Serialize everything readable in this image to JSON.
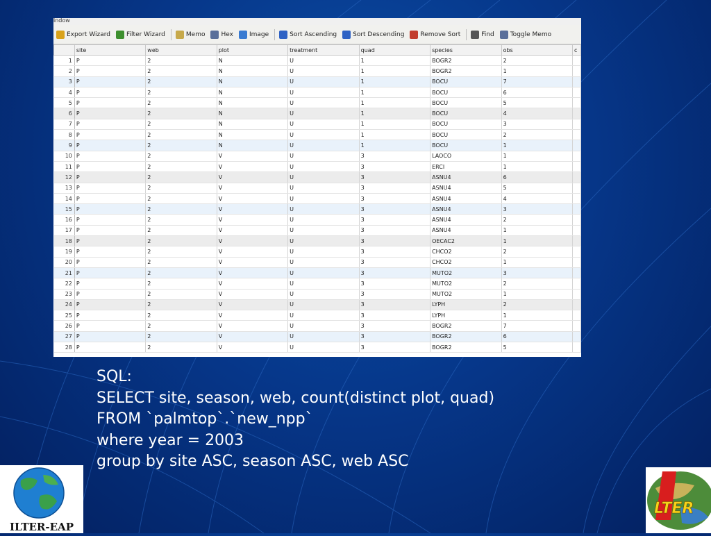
{
  "window": {
    "title": "indow"
  },
  "toolbar": {
    "items": [
      {
        "label": "Export Wizard",
        "icon": "export-icon"
      },
      {
        "label": "Filter Wizard",
        "icon": "filter-icon"
      },
      {
        "label": "Memo",
        "icon": "memo-icon"
      },
      {
        "label": "Hex",
        "icon": "hex-icon"
      },
      {
        "label": "Image",
        "icon": "image-icon"
      },
      {
        "label": "Sort Ascending",
        "icon": "sort-ascending-icon"
      },
      {
        "label": "Sort Descending",
        "icon": "sort-descending-icon"
      },
      {
        "label": "Remove Sort",
        "icon": "remove-sort-icon"
      },
      {
        "label": "Find",
        "icon": "find-icon"
      },
      {
        "label": "Toggle Memo",
        "icon": "toggle-memo-icon"
      }
    ]
  },
  "table": {
    "columns": [
      "site",
      "web",
      "plot",
      "treatment",
      "quad",
      "species",
      "obs",
      "c"
    ],
    "rows": [
      [
        "1",
        "P",
        "2",
        "N",
        "U",
        "1",
        "BOGR2",
        "2"
      ],
      [
        "2",
        "P",
        "2",
        "N",
        "U",
        "1",
        "BOGR2",
        "1"
      ],
      [
        "3",
        "P",
        "2",
        "N",
        "U",
        "1",
        "BOCU",
        "7"
      ],
      [
        "4",
        "P",
        "2",
        "N",
        "U",
        "1",
        "BOCU",
        "6"
      ],
      [
        "5",
        "P",
        "2",
        "N",
        "U",
        "1",
        "BOCU",
        "5"
      ],
      [
        "6",
        "P",
        "2",
        "N",
        "U",
        "1",
        "BOCU",
        "4"
      ],
      [
        "7",
        "P",
        "2",
        "N",
        "U",
        "1",
        "BOCU",
        "3"
      ],
      [
        "8",
        "P",
        "2",
        "N",
        "U",
        "1",
        "BOCU",
        "2"
      ],
      [
        "9",
        "P",
        "2",
        "N",
        "U",
        "1",
        "BOCU",
        "1"
      ],
      [
        "10",
        "P",
        "2",
        "V",
        "U",
        "3",
        "LAOCO",
        "1"
      ],
      [
        "11",
        "P",
        "2",
        "V",
        "U",
        "3",
        "ERCI",
        "1"
      ],
      [
        "12",
        "P",
        "2",
        "V",
        "U",
        "3",
        "ASNU4",
        "6"
      ],
      [
        "13",
        "P",
        "2",
        "V",
        "U",
        "3",
        "ASNU4",
        "5"
      ],
      [
        "14",
        "P",
        "2",
        "V",
        "U",
        "3",
        "ASNU4",
        "4"
      ],
      [
        "15",
        "P",
        "2",
        "V",
        "U",
        "3",
        "ASNU4",
        "3"
      ],
      [
        "16",
        "P",
        "2",
        "V",
        "U",
        "3",
        "ASNU4",
        "2"
      ],
      [
        "17",
        "P",
        "2",
        "V",
        "U",
        "3",
        "ASNU4",
        "1"
      ],
      [
        "18",
        "P",
        "2",
        "V",
        "U",
        "3",
        "OECAC2",
        "1"
      ],
      [
        "19",
        "P",
        "2",
        "V",
        "U",
        "3",
        "CHCO2",
        "2"
      ],
      [
        "20",
        "P",
        "2",
        "V",
        "U",
        "3",
        "CHCO2",
        "1"
      ],
      [
        "21",
        "P",
        "2",
        "V",
        "U",
        "3",
        "MUTO2",
        "3"
      ],
      [
        "22",
        "P",
        "2",
        "V",
        "U",
        "3",
        "MUTO2",
        "2"
      ],
      [
        "23",
        "P",
        "2",
        "V",
        "U",
        "3",
        "MUTO2",
        "1"
      ],
      [
        "24",
        "P",
        "2",
        "V",
        "U",
        "3",
        "LYPH",
        "2"
      ],
      [
        "25",
        "P",
        "2",
        "V",
        "U",
        "3",
        "LYPH",
        "1"
      ],
      [
        "26",
        "P",
        "2",
        "V",
        "U",
        "3",
        "BOGR2",
        "7"
      ],
      [
        "27",
        "P",
        "2",
        "V",
        "U",
        "3",
        "BOGR2",
        "6"
      ],
      [
        "28",
        "P",
        "2",
        "V",
        "U",
        "3",
        "BOGR2",
        "5"
      ]
    ],
    "row_styles": [
      "",
      "",
      "alt",
      "",
      "",
      "gray",
      "",
      "",
      "alt",
      "",
      "",
      "gray",
      "",
      "",
      "alt",
      "",
      "",
      "gray",
      "",
      "",
      "alt",
      "",
      "",
      "gray",
      "",
      "",
      "alt",
      ""
    ]
  },
  "sql": {
    "lines": [
      "SQL:",
      "SELECT site, season, web, count(distinct plot, quad)",
      "FROM `palmtop`.`new_npp`",
      "where year = 2003",
      "group by site ASC, season ASC, web ASC"
    ]
  },
  "logos": {
    "left_label": "ILTER-EAP",
    "right_label": "LTER"
  },
  "colors": {
    "background": "#06378a",
    "sql_text": "#ffffff"
  }
}
